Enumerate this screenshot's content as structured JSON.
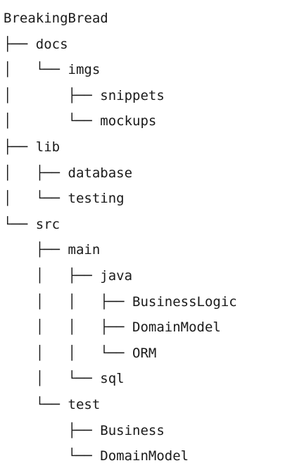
{
  "tree": {
    "lines": [
      "BreakingBread",
      "├── docs",
      "│   └── imgs",
      "│       ├── snippets",
      "│       └── mockups",
      "├── lib",
      "│   ├── database",
      "│   └── testing",
      "└── src",
      "    ├── main",
      "    │   ├── java",
      "    │   │   ├── BusinessLogic",
      "    │   │   ├── DomainModel",
      "    │   │   └── ORM",
      "    │   └── sql",
      "    └── test",
      "        ├── Business",
      "        └── DomainModel"
    ]
  }
}
